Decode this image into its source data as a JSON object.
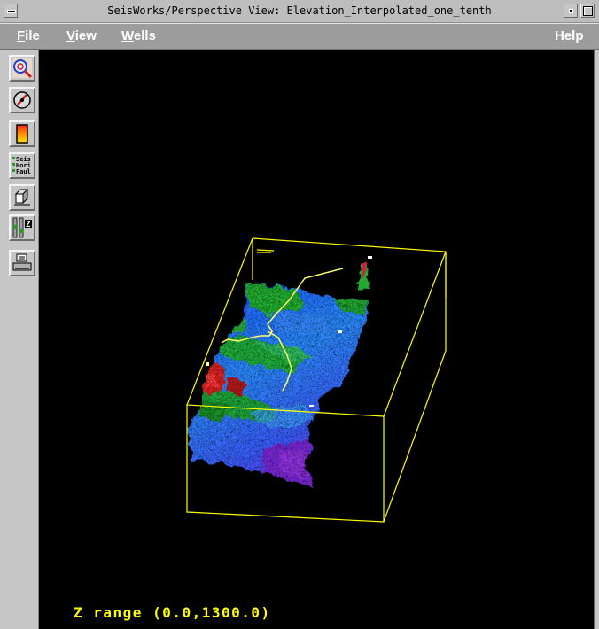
{
  "window": {
    "title": "SeisWorks/Perspective View: Elevation_Interpolated_one_tenth"
  },
  "menubar": {
    "file": "File",
    "view": "View",
    "wells": "Wells",
    "help": "Help"
  },
  "toolbar": {
    "tools": [
      {
        "icon": "zoom-icon"
      },
      {
        "icon": "rotate-gauge-icon"
      },
      {
        "icon": "color-scale-icon"
      },
      {
        "icon": "layer-list-icon",
        "labels": [
          "Seis",
          "Hori",
          "Faul"
        ]
      },
      {
        "icon": "3d-box-icon"
      },
      {
        "icon": "z-scale-icon",
        "label": "Z"
      },
      {
        "icon": "printer-icon"
      }
    ]
  },
  "viewport": {
    "z_range_text": "Z range (0.0,1300.0)",
    "colors": {
      "background": "#000000",
      "bounding_box": "#ffff00",
      "well_path": "#ffff66"
    }
  }
}
